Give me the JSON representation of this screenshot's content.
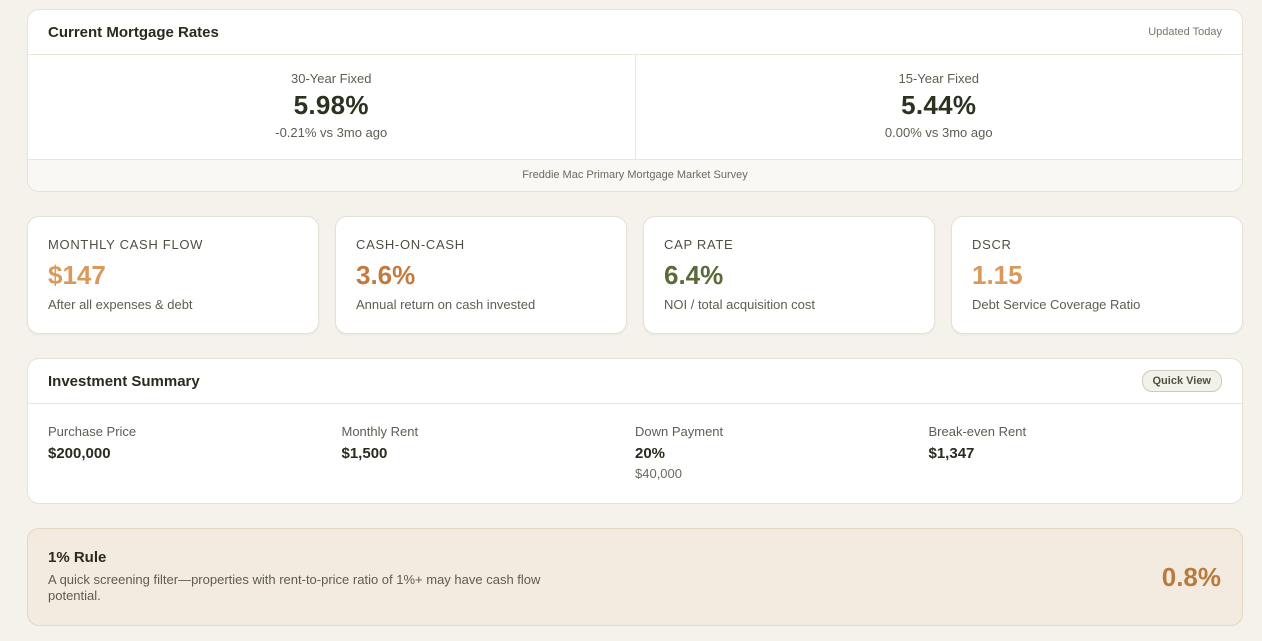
{
  "rates": {
    "title": "Current Mortgage Rates",
    "updated": "Updated Today",
    "items": [
      {
        "name": "30-Year Fixed",
        "value": "5.98%",
        "change": "-0.21% vs 3mo ago"
      },
      {
        "name": "15-Year Fixed",
        "value": "5.44%",
        "change": "0.00% vs 3mo ago"
      }
    ],
    "source": "Freddie Mac Primary Mortgage Market Survey"
  },
  "metrics": [
    {
      "label": "MONTHLY CASH FLOW",
      "value": "$147",
      "desc": "After all expenses & debt",
      "color": "#d9995a"
    },
    {
      "label": "CASH-ON-CASH",
      "value": "3.6%",
      "desc": "Annual return on cash invested",
      "color": "#c27a3e"
    },
    {
      "label": "CAP RATE",
      "value": "6.4%",
      "desc": "NOI / total acquisition cost",
      "color": "#5a6a3a"
    },
    {
      "label": "DSCR",
      "value": "1.15",
      "desc": "Debt Service Coverage Ratio",
      "color": "#d9995a"
    }
  ],
  "summary": {
    "title": "Investment Summary",
    "badge": "Quick View",
    "items": [
      {
        "label": "Purchase Price",
        "value": "$200,000",
        "sub": ""
      },
      {
        "label": "Monthly Rent",
        "value": "$1,500",
        "sub": ""
      },
      {
        "label": "Down Payment",
        "value": "20%",
        "sub": "$40,000"
      },
      {
        "label": "Break-even Rent",
        "value": "$1,347",
        "sub": ""
      }
    ]
  },
  "rule": {
    "title": "1% Rule",
    "desc": "A quick screening filter—properties with rent-to-price ratio of 1%+ may have cash flow potential.",
    "value": "0.8%"
  }
}
